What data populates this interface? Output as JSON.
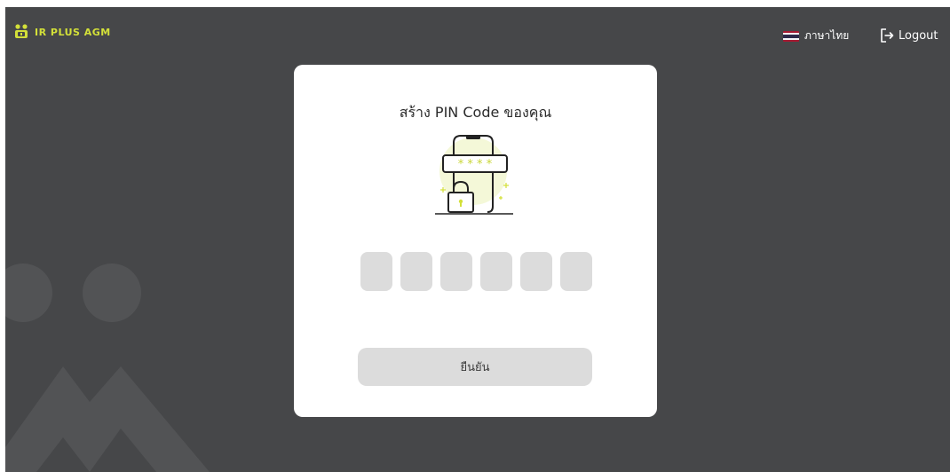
{
  "header": {
    "brand_name": "IR PLUS AGM",
    "brand_color": "#d3e039",
    "language_label": "ภาษาไทย",
    "language_icon": "thai-flag-icon",
    "logout_label": "Logout",
    "logout_icon": "logout-icon"
  },
  "card": {
    "title": "สร้าง PIN Code ของคุณ",
    "illustration_icon": "phone-password-lock-icon",
    "pin_digit_count": 6,
    "pin_values": [
      "",
      "",
      "",
      "",
      "",
      ""
    ],
    "confirm_label": "ยืนยัน"
  },
  "colors": {
    "background": "#464749",
    "card": "#ffffff",
    "input": "#dcdcdc",
    "accent": "#d3e039"
  }
}
